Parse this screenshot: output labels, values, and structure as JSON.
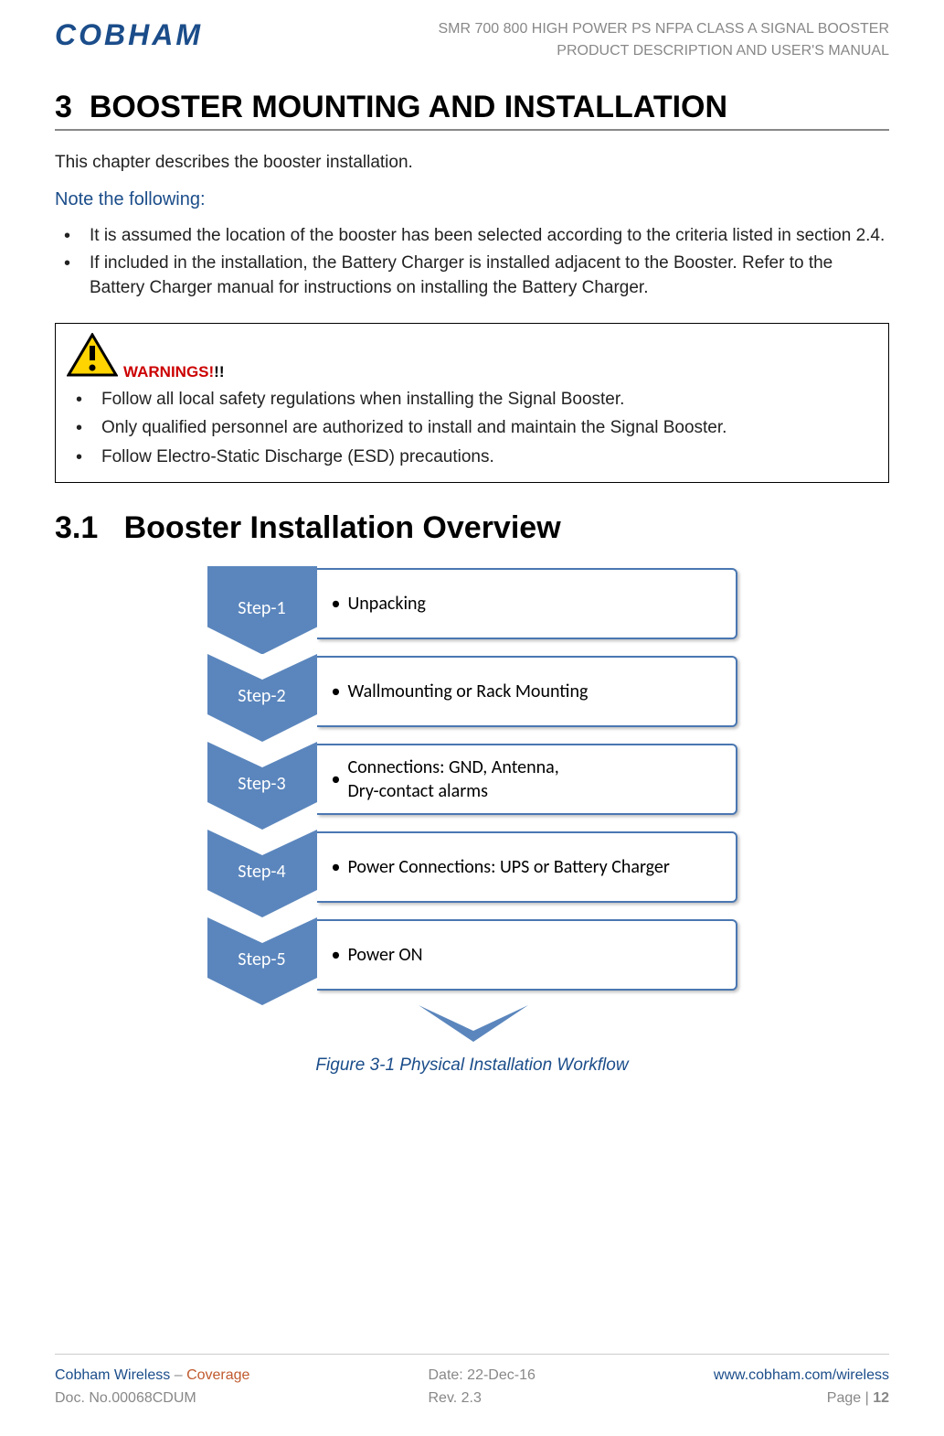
{
  "header": {
    "logo_text": "COBHAM",
    "title_line1": "SMR 700 800 HIGH POWER PS NFPA CLASS A SIGNAL BOOSTER",
    "title_line2": "PRODUCT DESCRIPTION AND USER'S MANUAL"
  },
  "section": {
    "number": "3",
    "title": "BOOSTER MOUNTING AND INSTALLATION",
    "intro": "This chapter describes the booster installation.",
    "note_heading": "Note the following:",
    "notes": [
      "It is assumed the location of the booster has been selected according to the criteria listed in section 2.4.",
      "If included in the installation, the Battery Charger is installed adjacent to the Booster. Refer to the Battery Charger manual for instructions on installing the Battery Charger."
    ]
  },
  "warnings": {
    "label": "WARNINGS!",
    "exclaims": "!!",
    "items": [
      "Follow all local safety regulations when installing the Signal Booster.",
      "Only qualified personnel are authorized to install and maintain the Signal Booster.",
      "Follow Electro-Static Discharge (ESD) precautions."
    ]
  },
  "subsection": {
    "number": "3.1",
    "title": "Booster Installation Overview"
  },
  "steps": [
    {
      "label": "Step-1",
      "text": "Unpacking"
    },
    {
      "label": "Step-2",
      "text": "Wallmounting or Rack Mounting"
    },
    {
      "label": "Step-3",
      "text": "Connections: GND, Antenna,\nDry-contact alarms"
    },
    {
      "label": "Step-4",
      "text": "Power Connections: UPS or Battery Charger"
    },
    {
      "label": "Step-5",
      "text": "Power ON"
    }
  ],
  "figure_caption": "Figure 3-1  Physical Installation Workflow",
  "footer": {
    "company": "Cobham Wireless",
    "dash": " – ",
    "coverage": "Coverage",
    "doc_label": "Doc. No.",
    "doc_no": "00068CDUM",
    "date_label": "Date: ",
    "date": "22-Dec-16",
    "rev_label": "Rev. ",
    "rev": "2.3",
    "url": "www.cobham.com/wireless",
    "page_label": "Page | ",
    "page_no": "12"
  },
  "colors": {
    "brand_blue": "#1b4d8a",
    "step_blue": "#4a77b2",
    "warn_red": "#c00",
    "orange": "#c05a2e"
  }
}
